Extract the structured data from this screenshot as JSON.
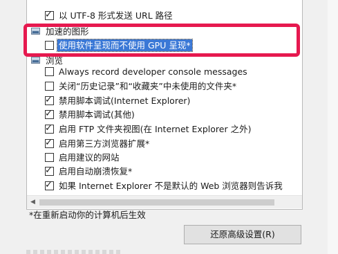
{
  "options": {
    "utf8_url": {
      "label": "以 UTF-8 形式发送 URL 路径",
      "checked": true
    },
    "accelerated_graphics": {
      "label": "加速的图形"
    },
    "software_rendering": {
      "label": "使用软件呈现而不使用 GPU 呈现*",
      "checked": false
    },
    "browsing": {
      "label": "浏览"
    },
    "items": [
      {
        "label": "Always record developer console messages",
        "checked": false
      },
      {
        "label": "关闭“历史记录”和“收藏夹”中未使用的文件夹*",
        "checked": false
      },
      {
        "label": "禁用脚本调试(Internet Explorer)",
        "checked": true
      },
      {
        "label": "禁用脚本调试(其他)",
        "checked": true
      },
      {
        "label": "启用 FTP 文件夹视图(在 Internet Explorer 之外)",
        "checked": true
      },
      {
        "label": "启用第三方浏览器扩展*",
        "checked": true
      },
      {
        "label": "启用建议的网站",
        "checked": false
      },
      {
        "label": "启用自动崩溃恢复*",
        "checked": true
      },
      {
        "label": "如果 Internet Explorer 不是默认的 Web 浏览器则告诉我",
        "checked": true
      }
    ]
  },
  "check_glyph": "✓",
  "note": "*在重新启动你的计算机后生效",
  "restore_button": "还原高级设置(R)",
  "colors": {
    "highlight": "#e6194f",
    "selection": "#3a78d6"
  }
}
